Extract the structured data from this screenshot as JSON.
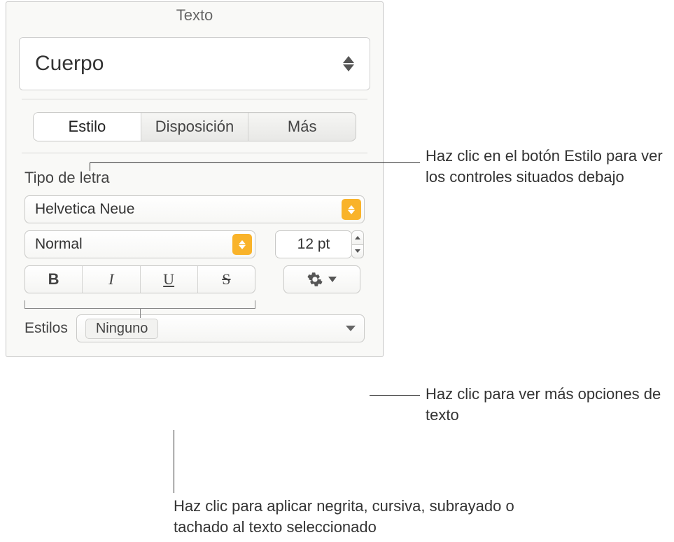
{
  "panel": {
    "title": "Texto",
    "style_name": "Cuerpo",
    "tabs": {
      "style": "Estilo",
      "layout": "Disposición",
      "more": "Más"
    },
    "font_section_label": "Tipo de letra",
    "font_family": "Helvetica Neue",
    "font_weight": "Normal",
    "font_size": "12 pt",
    "bius": {
      "bold": "B",
      "italic": "I",
      "underline": "U",
      "strike": "S"
    },
    "char_styles_label": "Estilos",
    "char_styles_value": "Ninguno"
  },
  "callouts": {
    "estilo": "Haz clic en el botón Estilo para ver los controles situados debajo",
    "gear": "Haz clic para ver más opciones de texto",
    "bius": "Haz clic para aplicar negrita, cursiva, subrayado o tachado al texto seleccionado"
  }
}
